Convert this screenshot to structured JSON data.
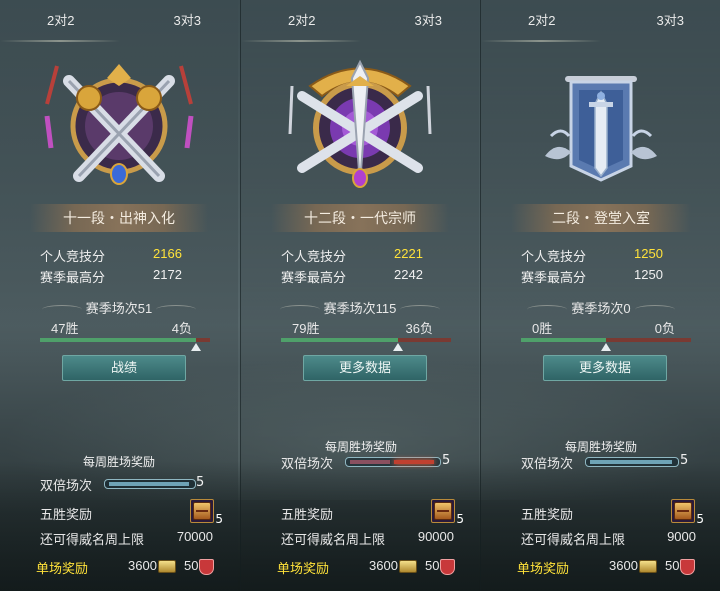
{
  "panels": [
    {
      "tabs": [
        "2对2",
        "3对3"
      ],
      "rank": "十一段・出神入化",
      "score_label": "个人竞技分",
      "score": "2166",
      "best_label": "赛季最高分",
      "best": "2172",
      "season_games": "赛季场次51",
      "wins": "47胜",
      "losses": "4负",
      "win_ratio": 0.92,
      "button": "战绩",
      "weekly_title": "每周胜场奖励",
      "double_label": "双倍场次",
      "double_count": "5",
      "five_win_label": "五胜奖励",
      "five_win_count": "5",
      "cap_label": "还可得威名周上限",
      "cap_value": "70000",
      "single_label": "单场奖励",
      "single_coin": "3600",
      "single_shield": "50"
    },
    {
      "tabs": [
        "2对2",
        "3对3"
      ],
      "rank": "十二段・一代宗师",
      "score_label": "个人竞技分",
      "score": "2221",
      "best_label": "赛季最高分",
      "best": "2242",
      "season_games": "赛季场次115",
      "wins": "79胜",
      "losses": "36负",
      "win_ratio": 0.687,
      "button": "更多数据",
      "weekly_title": "每周胜场奖励",
      "double_label": "双倍场次",
      "double_count": "5",
      "five_win_label": "五胜奖励",
      "five_win_count": "5",
      "cap_label": "还可得威名周上限",
      "cap_value": "90000",
      "single_label": "单场奖励",
      "single_coin": "3600",
      "single_shield": "50"
    },
    {
      "tabs": [
        "2对2",
        "3对3"
      ],
      "rank": "二段・登堂入室",
      "score_label": "个人竞技分",
      "score": "1250",
      "best_label": "赛季最高分",
      "best": "1250",
      "season_games": "赛季场次0",
      "wins": "0胜",
      "losses": "0负",
      "win_ratio": 0.5,
      "button": "更多数据",
      "weekly_title": "每周胜场奖励",
      "double_label": "双倍场次",
      "double_count": "5",
      "five_win_label": "五胜奖励",
      "five_win_count": "5",
      "cap_label": "还可得威名周上限",
      "cap_value": "9000",
      "single_label": "单场奖励",
      "single_coin": "3600",
      "single_shield": "50"
    }
  ],
  "colors": {
    "gold_text": "#ffe23a",
    "win_bar": "#4fa06a",
    "loss_bar": "#7a3a32",
    "button": "#3b7676"
  },
  "icons": [
    "crossed-swords-emblem-icon",
    "grandmaster-sword-emblem-icon",
    "banner-sword-emblem-icon",
    "chest-icon",
    "coin-icon",
    "shield-icon"
  ]
}
